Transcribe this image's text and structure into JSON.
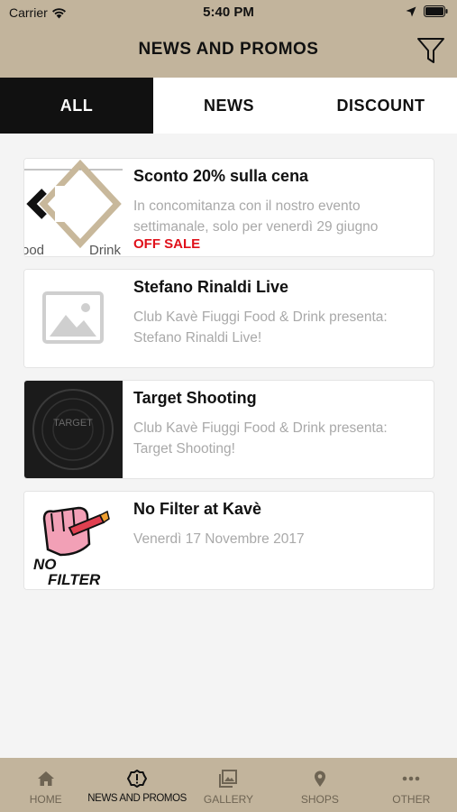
{
  "status_bar": {
    "carrier": "Carrier",
    "time": "5:40 PM"
  },
  "header": {
    "title": "NEWS AND PROMOS"
  },
  "tabs": [
    {
      "label": "ALL",
      "active": true
    },
    {
      "label": "NEWS",
      "active": false
    },
    {
      "label": "DISCOUNT",
      "active": false
    }
  ],
  "items": [
    {
      "title": "Sconto 20% sulla cena",
      "description": "In concomitanza con il nostro evento settimanale, solo per venerdì 29 giugno",
      "badge": "OFF SALE",
      "thumb_text_left": "ood",
      "thumb_text_right": "Drink"
    },
    {
      "title": "Stefano Rinaldi Live",
      "description": "Club Kavè Fiuggi Food & Drink presenta: Stefano Rinaldi Live!"
    },
    {
      "title": "Target Shooting",
      "description": "Club Kavè Fiuggi Food & Drink presenta: Target Shooting!",
      "thumb_text": "TARGET"
    },
    {
      "title": "No Filter at Kavè",
      "description": "Venerdì 17 Novembre 2017",
      "thumb_text_top": "NO",
      "thumb_text_bottom": "FILTER"
    }
  ],
  "tabbar": [
    {
      "label": "HOME",
      "icon": "home-icon"
    },
    {
      "label": "NEWS AND PROMOS",
      "icon": "alert-icon",
      "active": true
    },
    {
      "label": "GALLERY",
      "icon": "gallery-icon"
    },
    {
      "label": "SHOPS",
      "icon": "location-pin-icon"
    },
    {
      "label": "OTHER",
      "icon": "more-icon"
    }
  ],
  "colors": {
    "bar": "#c2b49c",
    "accent_red": "#e0101a",
    "active_tab": "#111111"
  }
}
